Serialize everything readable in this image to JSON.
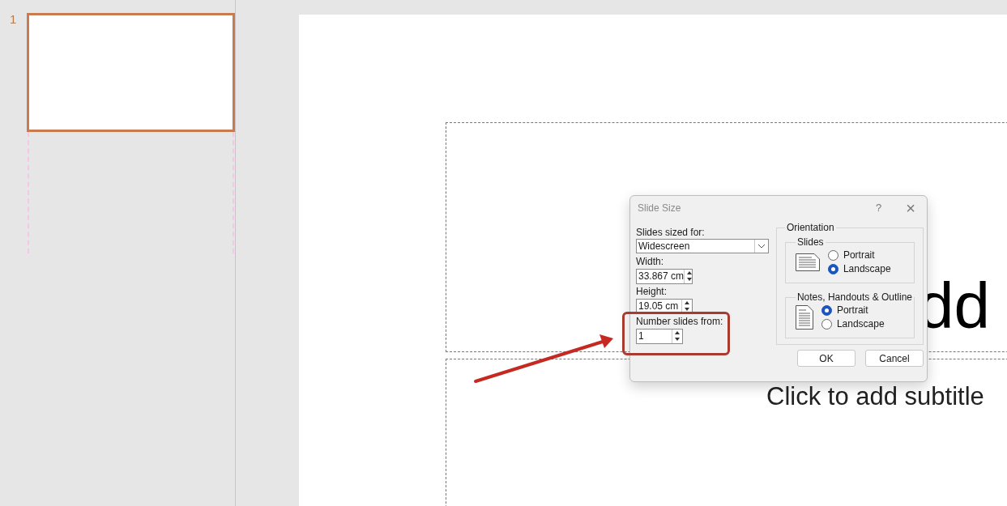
{
  "thumbnails": [
    {
      "number": "1",
      "selected": true
    }
  ],
  "slide": {
    "title": "dd",
    "subtitle": "Click to add subtitle"
  },
  "dialog": {
    "title": "Slide Size",
    "help": "?",
    "close": "×",
    "sized_for": {
      "label": "Slides sized for:",
      "value": "Widescreen"
    },
    "width": {
      "label": "Width:",
      "value": "33.867 cm"
    },
    "height": {
      "label": "Height:",
      "value": "19.05 cm"
    },
    "number_from": {
      "label": "Number slides from:",
      "value": "1"
    },
    "orientation": {
      "label": "Orientation",
      "groups": [
        {
          "label": "Slides",
          "kind": "landscape",
          "options": [
            {
              "label": "Portrait",
              "selected": false
            },
            {
              "label": "Landscape",
              "selected": true
            }
          ]
        },
        {
          "label": "Notes, Handouts & Outline",
          "kind": "portrait",
          "options": [
            {
              "label": "Portrait",
              "selected": true
            },
            {
              "label": "Landscape",
              "selected": false
            }
          ]
        }
      ]
    },
    "buttons": [
      "OK",
      "Cancel"
    ]
  }
}
